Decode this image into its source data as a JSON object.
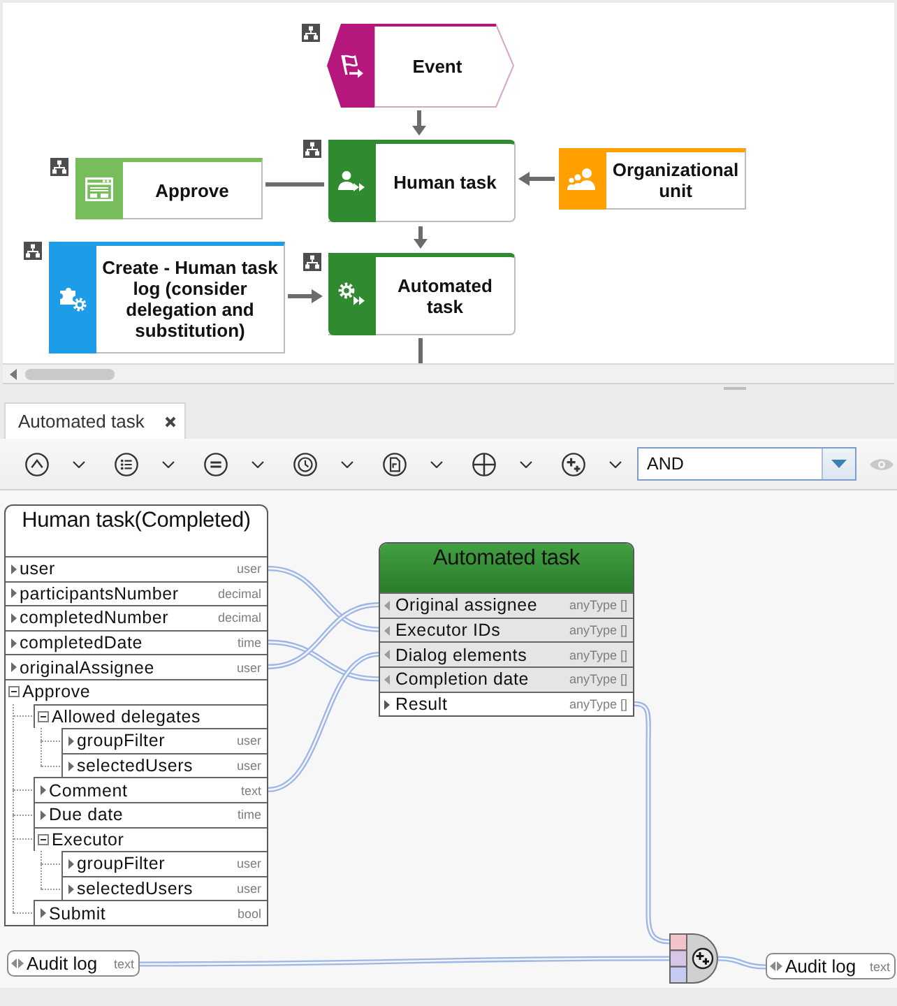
{
  "diagram": {
    "nodes": [
      {
        "kind": "event",
        "label": "Event",
        "color": "#b5177c",
        "assignment": true
      },
      {
        "kind": "form",
        "label": "Approve",
        "color": "#78bd5b",
        "assignment": true
      },
      {
        "kind": "human",
        "label": "Human task",
        "color": "#2f8a30",
        "assignment": true
      },
      {
        "kind": "orgunit",
        "label": "Organizational unit",
        "color": "#ff9f00",
        "assignment": false
      },
      {
        "kind": "script",
        "label": "Create - Human task log (consider delegation and substitution)",
        "color": "#1d9ce8",
        "assignment": true
      },
      {
        "kind": "automated",
        "label": "Automated task",
        "color": "#2f8a30",
        "assignment": true
      }
    ]
  },
  "tabs": [
    {
      "label": "Automated task",
      "selected": true,
      "closable": true
    }
  ],
  "toolbar": {
    "tools": [
      {
        "kind": "up",
        "dropdown": true,
        "disabled": false
      },
      {
        "kind": "list",
        "dropdown": true,
        "disabled": false
      },
      {
        "kind": "equals",
        "dropdown": true,
        "disabled": false
      },
      {
        "kind": "clock",
        "dropdown": true,
        "disabled": false
      },
      {
        "kind": "document",
        "dropdown": true,
        "disabled": false
      },
      {
        "kind": "plus",
        "dropdown": true,
        "disabled": false
      },
      {
        "kind": "sparkle",
        "dropdown": true,
        "disabled": false
      }
    ],
    "operator": {
      "value": "AND"
    },
    "visibility_toggle": {
      "disabled": true
    }
  },
  "mapping": {
    "source": {
      "title": "Human task(Completed)",
      "rows": [
        {
          "name": "user",
          "type": "user",
          "expanded": false
        },
        {
          "name": "participantsNumber",
          "type": "decimal",
          "expanded": false
        },
        {
          "name": "completedNumber",
          "type": "decimal",
          "expanded": false
        },
        {
          "name": "completedDate",
          "type": "time",
          "expanded": false
        },
        {
          "name": "originalAssignee",
          "type": "user",
          "expanded": false
        },
        {
          "name": "Approve",
          "expanded": true,
          "children": [
            {
              "name": "Allowed delegates",
              "expanded": true,
              "children": [
                {
                  "name": "groupFilter",
                  "type": "user",
                  "expanded": false
                },
                {
                  "name": "selectedUsers",
                  "type": "user",
                  "expanded": false
                }
              ]
            },
            {
              "name": "Comment",
              "type": "text",
              "expanded": false
            },
            {
              "name": "Due date",
              "type": "time",
              "expanded": false
            },
            {
              "name": "Executor",
              "expanded": true,
              "children": [
                {
                  "name": "groupFilter",
                  "type": "user",
                  "expanded": false
                },
                {
                  "name": "selectedUsers",
                  "type": "user",
                  "expanded": false
                }
              ]
            },
            {
              "name": "Submit",
              "type": "bool",
              "expanded": false
            }
          ]
        }
      ]
    },
    "target": {
      "title": "Automated task",
      "rows": [
        {
          "kind": "input",
          "name": "Original assignee",
          "type": "anyType []"
        },
        {
          "kind": "input",
          "name": "Executor IDs",
          "type": "anyType []"
        },
        {
          "kind": "input",
          "name": "Dialog elements",
          "type": "anyType []"
        },
        {
          "kind": "input",
          "name": "Completion date",
          "type": "anyType []"
        },
        {
          "kind": "output",
          "name": "Result",
          "type": "anyType []"
        }
      ]
    },
    "inputs": [
      {
        "name": "Audit log",
        "type": "text"
      }
    ],
    "outputs": [
      {
        "name": "Audit log",
        "type": "text"
      }
    ]
  }
}
